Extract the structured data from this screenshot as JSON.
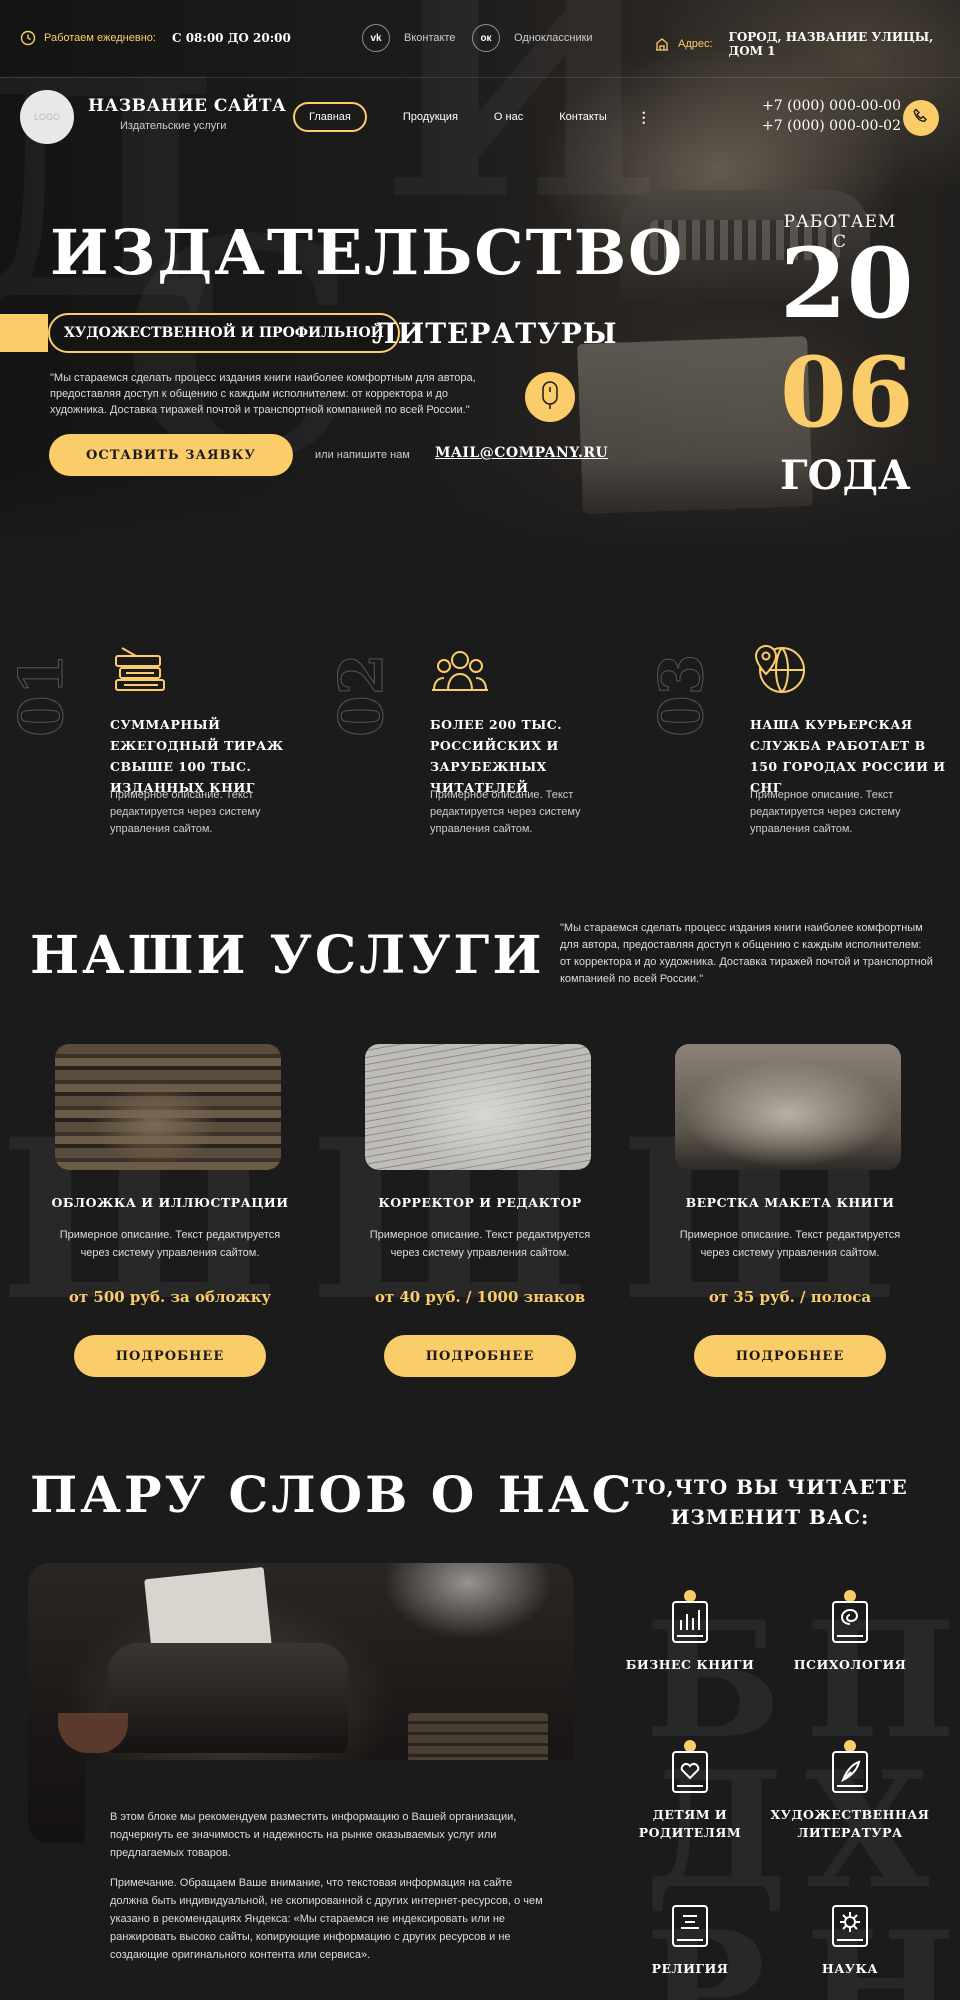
{
  "topbar": {
    "hours_label": "Работаем ежедневно:",
    "hours_value": "С 08:00 ДО 20:00",
    "vk_label": "Вконтакте",
    "ok_label": "Одноклассники",
    "address_label": "Адрес:",
    "address_value": "ГОРОД, НАЗВАНИЕ УЛИЦЫ, ДОМ 1"
  },
  "header": {
    "logo_text": "LOGO",
    "site_name": "НАЗВАНИЕ САЙТА",
    "site_sub": "Издательские услуги",
    "nav": [
      "Главная",
      "Продукция",
      "О нас",
      "Контакты"
    ],
    "more": "⋮",
    "phone1": "+7 (000) 000-00-00",
    "phone2": "+7 (000) 000-00-02"
  },
  "hero": {
    "title": "ИЗДАТЕЛЬСТВО",
    "pill": "ХУДОЖЕСТВЕННОЙ И ПРОФИЛЬНОЙ",
    "title2": "ЛИТЕРАТУРЫ",
    "quote": "\"Мы стараемся сделать процесс издания книги наиболее комфортным для автора, предоставляя доступ к общению с каждым исполнителем: от корректора и до художника. Доставка тиражей почтой и транспортной компанией по всей России.\"",
    "cta": "ОСТАВИТЬ ЗАЯВКУ",
    "write_to": "или напишите нам",
    "email": "MAIL@COMPANY.RU",
    "since_pre": "РАБОТАЕМ С",
    "since_20": "20",
    "since_06": "06",
    "since_post": "ГОДА"
  },
  "stats": [
    {
      "num": "01",
      "title": "СУММАРНЫЙ ЕЖЕГОДНЫЙ ТИРАЖ СВЫШЕ 100 ТЫС. ИЗДАННЫХ КНИГ",
      "desc": "Примерное описание. Текст редактируется через систему управления сайтом.",
      "icon": "books-stack-icon"
    },
    {
      "num": "02",
      "title": "БОЛЕЕ 200 ТЫС. РОССИЙСКИХ И ЗАРУБЕЖНЫХ ЧИТАТЕЛЕЙ",
      "desc": "Примерное описание. Текст редактируется через систему управления сайтом.",
      "icon": "readers-group-icon"
    },
    {
      "num": "03",
      "title": "НАША КУРЬЕРСКАЯ СЛУЖБА РАБОТАЕТ В 150 ГОРОДАХ РОССИИ И СНГ",
      "desc": "Примерное описание. Текст редактируется через систему управления сайтом.",
      "icon": "globe-pin-icon"
    }
  ],
  "services": {
    "title": "НАШИ УСЛУГИ",
    "quote": "\"Мы стараемся сделать процесс издания книги наиболее комфортным для автора, предоставляя доступ к общению с каждым исполнителем: от корректора и до художника. Доставка тиражей почтой и транспортной компанией по всей России.\"",
    "cards": [
      {
        "title": "ОБЛОЖКА И ИЛЛЮСТРАЦИИ",
        "desc": "Примерное описание. Текст редактируется через систему управления сайтом.",
        "price": "от 500 руб. за обложку",
        "button": "ПОДРОБНЕЕ"
      },
      {
        "title": "КОРРЕКТОР И РЕДАКТОР",
        "desc": "Примерное описание. Текст редактируется через систему управления сайтом.",
        "price": "от 40 руб. / 1000 знаков",
        "button": "ПОДРОБНЕЕ"
      },
      {
        "title": "ВЕРСТКА МАКЕТА КНИГИ",
        "desc": "Примерное описание. Текст редактируется через систему управления сайтом.",
        "price": "от 35 руб. / полоса",
        "button": "ПОДРОБНЕЕ"
      }
    ]
  },
  "about": {
    "title": "ПАРУ СЛОВ О НАС",
    "p1": "В этом блоке мы рекомендуем разместить информацию о Вашей организации, подчеркнуть ее значимость и надежность на рынке оказываемых услуг или предлагаемых товаров.",
    "p2": "Примечание. Обращаем Ваше внимание, что текстовая информация на сайте должна быть индивидуальной, не скопированной с других интернет-ресурсов, о чем указано в рекомендациях Яндекса: «Мы стараемся не индексировать или не ранжировать высоко сайты, копирующие информацию с других ресурсов и не создающие оригинального контента или сервиса»."
  },
  "reading": {
    "title": "ТО,ЧТО ВЫ ЧИТАЕТЕ ИЗМЕНИТ ВАС:",
    "genres": [
      {
        "label": "БИЗНЕС КНИГИ",
        "icon": "business-book-icon"
      },
      {
        "label": "ПСИХОЛОГИЯ",
        "icon": "psychology-book-icon"
      },
      {
        "label": "ДЕТЯМ И РОДИТЕЛЯМ",
        "icon": "family-book-icon"
      },
      {
        "label": "ХУДОЖЕСТВЕННАЯ ЛИТЕРАТУРА",
        "icon": "fiction-book-icon"
      },
      {
        "label": "РЕЛИГИЯ",
        "icon": "religion-book-icon"
      },
      {
        "label": "НАУКА",
        "icon": "science-book-icon"
      }
    ]
  },
  "colors": {
    "accent": "#fbcd6a",
    "background": "#1b1b1b",
    "text": "#ffffff"
  }
}
